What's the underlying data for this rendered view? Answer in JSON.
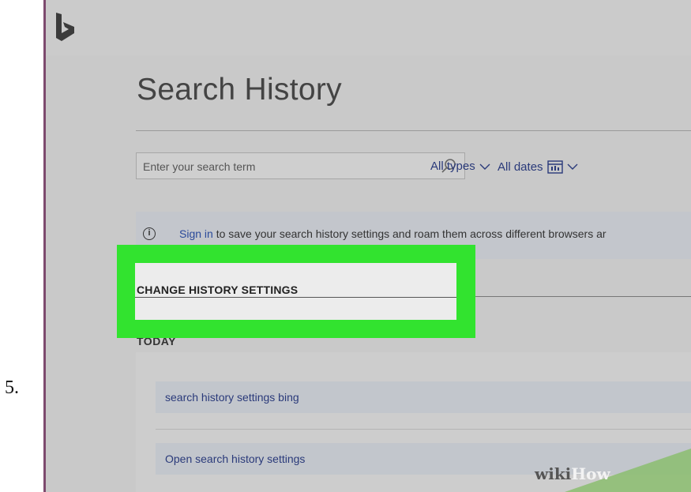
{
  "step": {
    "number": "5."
  },
  "header": {
    "logo_icon": "bing-logo"
  },
  "page": {
    "title": "Search History"
  },
  "search": {
    "placeholder": "Enter your search term",
    "icon": "search-icon"
  },
  "filters": {
    "types_label": "All types",
    "dates_label": "All dates",
    "chevron_icon": "chevron-down-icon",
    "calendar_icon": "calendar-icon"
  },
  "info_banner": {
    "icon": "info-icon",
    "link_text": "Sign in",
    "message": " to save your search history settings and roam them across different browsers ar"
  },
  "settings": {
    "heading": "CHANGE HISTORY SETTINGS"
  },
  "history": {
    "group_label": "TODAY",
    "items": [
      {
        "label": "search history settings bing"
      },
      {
        "label": "Open search history settings"
      }
    ]
  },
  "watermark": {
    "part1": "wiki",
    "part2": "How"
  },
  "colors": {
    "highlight": "#32e32f",
    "link": "#2a4a9a",
    "watermark_bg": "#8bbd6e"
  }
}
